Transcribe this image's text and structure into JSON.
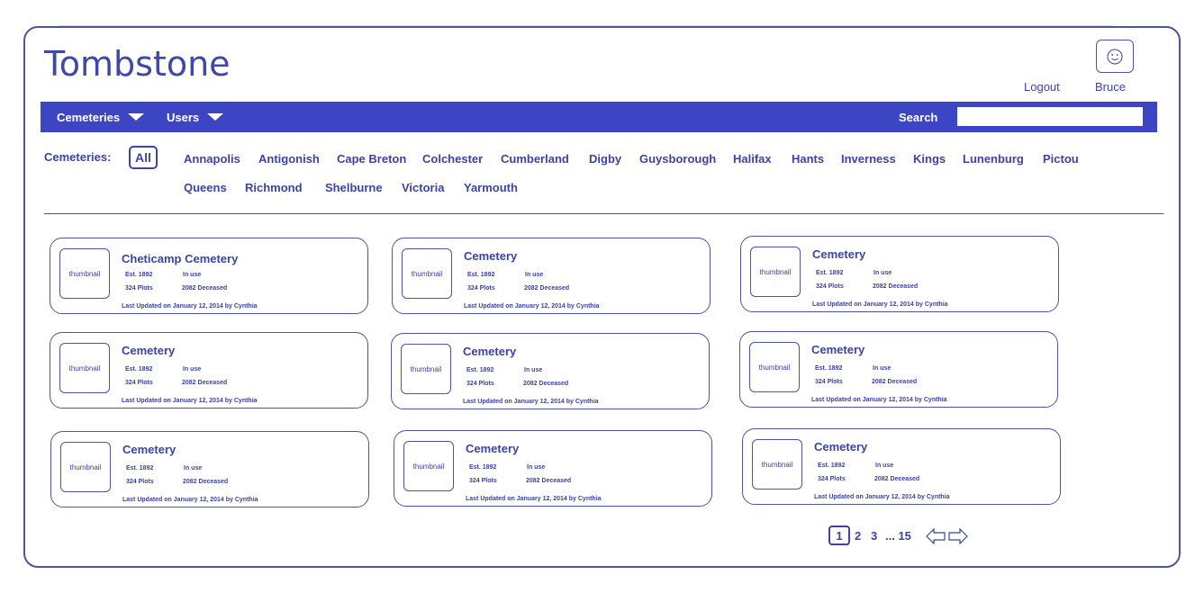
{
  "app": {
    "title": "Tombstone"
  },
  "header": {
    "logout_label": "Logout",
    "username": "Bruce",
    "avatar_icon": "smiley-face-icon"
  },
  "nav": {
    "items": [
      {
        "label": "Cemeteries",
        "icon": "chevron-down-icon"
      },
      {
        "label": "Users",
        "icon": "chevron-down-icon"
      }
    ],
    "search_label": "Search",
    "search_value": ""
  },
  "filter": {
    "label": "Cemeteries:",
    "selected": "All",
    "counties": [
      "Annapolis",
      "Antigonish",
      "Cape Breton",
      "Colchester",
      "Cumberland",
      "Digby",
      "Guysborough",
      "Halifax",
      "Hants",
      "Inverness",
      "Kings",
      "Lunenburg",
      "Pictou",
      "Queens",
      "Richmond",
      "Shelburne",
      "Victoria",
      "Yarmouth"
    ]
  },
  "cards": [
    {
      "thumb": "thumbnail",
      "name": "Cheticamp Cemetery",
      "est": "Est. 1892",
      "status": "In use",
      "plots": "324 Plots",
      "deceased": "2082 Deceased",
      "updated": "Last Updated on January 12, 2014 by Cynthia"
    },
    {
      "thumb": "thumbnail",
      "name": "Cemetery",
      "est": "Est. 1892",
      "status": "In use",
      "plots": "324 Plots",
      "deceased": "2082 Deceased",
      "updated": "Last Updated on January 12, 2014 by Cynthia"
    },
    {
      "thumb": "thumbnail",
      "name": "Cemetery",
      "est": "Est. 1892",
      "status": "In use",
      "plots": "324 Plots",
      "deceased": "2082 Deceased",
      "updated": "Last Updated on January 12, 2014 by Cynthia"
    },
    {
      "thumb": "thumbnail",
      "name": "Cemetery",
      "est": "Est. 1892",
      "status": "In use",
      "plots": "324 Plots",
      "deceased": "2082 Deceased",
      "updated": "Last Updated on January 12, 2014 by Cynthia"
    },
    {
      "thumb": "thumbnail",
      "name": "Cemetery",
      "est": "Est. 1892",
      "status": "In use",
      "plots": "324 Plots",
      "deceased": "2082 Deceased",
      "updated": "Last Updated on January 12, 2014 by Cynthia"
    },
    {
      "thumb": "thumbnail",
      "name": "Cemetery",
      "est": "Est. 1892",
      "status": "In use",
      "plots": "324 Plots",
      "deceased": "2082 Deceased",
      "updated": "Last Updated on January 12, 2014 by Cynthia"
    },
    {
      "thumb": "thumbnail",
      "name": "Cemetery",
      "est": "Est. 1892",
      "status": "In use",
      "plots": "324 Plots",
      "deceased": "2082 Deceased",
      "updated": "Last Updated on January 12, 2014 by Cynthia"
    },
    {
      "thumb": "thumbnail",
      "name": "Cemetery",
      "est": "Est. 1892",
      "status": "In use",
      "plots": "324 Plots",
      "deceased": "2082 Deceased",
      "updated": "Last Updated on January 12, 2014 by Cynthia"
    },
    {
      "thumb": "thumbnail",
      "name": "Cemetery",
      "est": "Est. 1892",
      "status": "In use",
      "plots": "324 Plots",
      "deceased": "2082 Deceased",
      "updated": "Last Updated on January 12, 2014 by Cynthia"
    }
  ],
  "pagination": {
    "current": "1",
    "pages": [
      "2",
      "3"
    ],
    "ellipsis_last": "... 15",
    "prev_icon": "arrow-left-icon",
    "next_icon": "arrow-right-icon"
  },
  "colors": {
    "accent": "#3c46c5",
    "text": "#3b43a8",
    "border": "#4d54a0"
  }
}
